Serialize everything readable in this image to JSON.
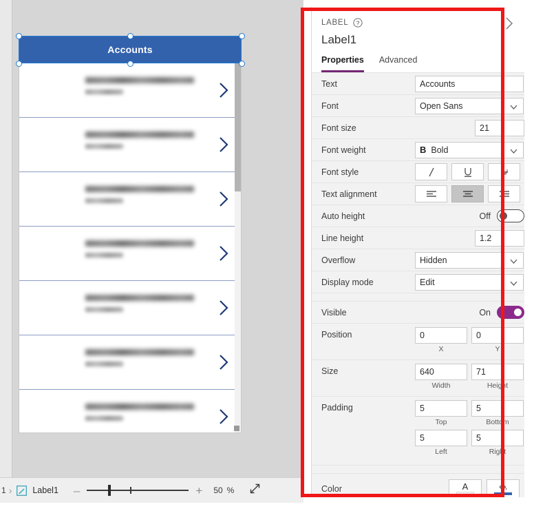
{
  "canvas": {
    "app_header_title": "Accounts",
    "gallery_items": [
      {
        "title": "[redacted]",
        "subtitle": "[redacted]"
      },
      {
        "title": "[redacted]",
        "subtitle": "[redacted]"
      },
      {
        "title": "[redacted]",
        "subtitle": "[redacted]"
      },
      {
        "title": "[redacted]",
        "subtitle": "[redacted]"
      },
      {
        "title": "[redacted]",
        "subtitle": "[redacted]"
      },
      {
        "title": "[redacted]",
        "subtitle": "[redacted]"
      },
      {
        "title": "[redacted]",
        "subtitle": "[redacted]"
      }
    ],
    "chevron_icon": "chevron-right-icon",
    "selection_handle_icon": "resize-handle"
  },
  "bottom_bar": {
    "breadcrumb_prev": "1",
    "breadcrumb_separator": "›",
    "breadcrumb_icon": "label-control-icon",
    "breadcrumb_current": "Label1",
    "zoom_out_label": "–",
    "zoom_in_label": "+",
    "zoom_value": "50",
    "zoom_unit": "%",
    "fit_screen_icon": "fit-to-screen-icon"
  },
  "panel": {
    "kicker": "LABEL",
    "help_icon": "help-icon",
    "collapse_icon": "chevron-right-icon",
    "object_name": "Label1",
    "tabs": [
      {
        "label": "Properties",
        "active": true
      },
      {
        "label": "Advanced",
        "active": false
      }
    ],
    "properties": {
      "text": {
        "label": "Text",
        "value": "Accounts"
      },
      "font": {
        "label": "Font",
        "value": "Open Sans"
      },
      "font_size": {
        "label": "Font size",
        "value": "21"
      },
      "font_weight": {
        "label": "Font weight",
        "value": "Bold",
        "prefix": "B"
      },
      "font_style": {
        "label": "Font style",
        "buttons": [
          {
            "name": "italic-icon",
            "glyph": "I",
            "selected": false
          },
          {
            "name": "underline-icon",
            "glyph": "U",
            "selected": false
          },
          {
            "name": "strikethrough-icon",
            "glyph": "S",
            "selected": false
          }
        ]
      },
      "text_alignment": {
        "label": "Text alignment",
        "buttons": [
          {
            "name": "align-left-icon",
            "selected": false
          },
          {
            "name": "align-center-icon",
            "selected": true
          },
          {
            "name": "align-right-icon",
            "selected": false
          },
          {
            "name": "align-justify-icon",
            "selected": false
          }
        ]
      },
      "auto_height": {
        "label": "Auto height",
        "state": "Off",
        "on": false
      },
      "line_height": {
        "label": "Line height",
        "value": "1.2"
      },
      "overflow": {
        "label": "Overflow",
        "value": "Hidden"
      },
      "display_mode": {
        "label": "Display mode",
        "value": "Edit"
      },
      "visible": {
        "label": "Visible",
        "state": "On",
        "on": true
      },
      "position": {
        "label": "Position",
        "x_value": "0",
        "x_sub": "X",
        "y_value": "0",
        "y_sub": "Y"
      },
      "size": {
        "label": "Size",
        "w_value": "640",
        "w_sub": "Width",
        "h_value": "71",
        "h_sub": "Height"
      },
      "padding": {
        "label": "Padding",
        "top_value": "5",
        "top_sub": "Top",
        "bottom_value": "5",
        "bottom_sub": "Bottom",
        "left_value": "5",
        "left_sub": "Left",
        "right_value": "5",
        "right_sub": "Right"
      },
      "color": {
        "label": "Color",
        "text_color_icon": "font-color-icon",
        "text_color_glyph": "A",
        "text_color_swatch": "#ffffff",
        "fill_color_icon": "fill-color-icon",
        "fill_color_swatch": "#3362ad"
      }
    }
  },
  "colors": {
    "app_header_blue": "#3362ad",
    "accent_purple": "#8c2a8c",
    "annotation_red": "#ef1717",
    "selection_blue": "#1f7ad4",
    "panel_bg": "#f2f2f2"
  }
}
